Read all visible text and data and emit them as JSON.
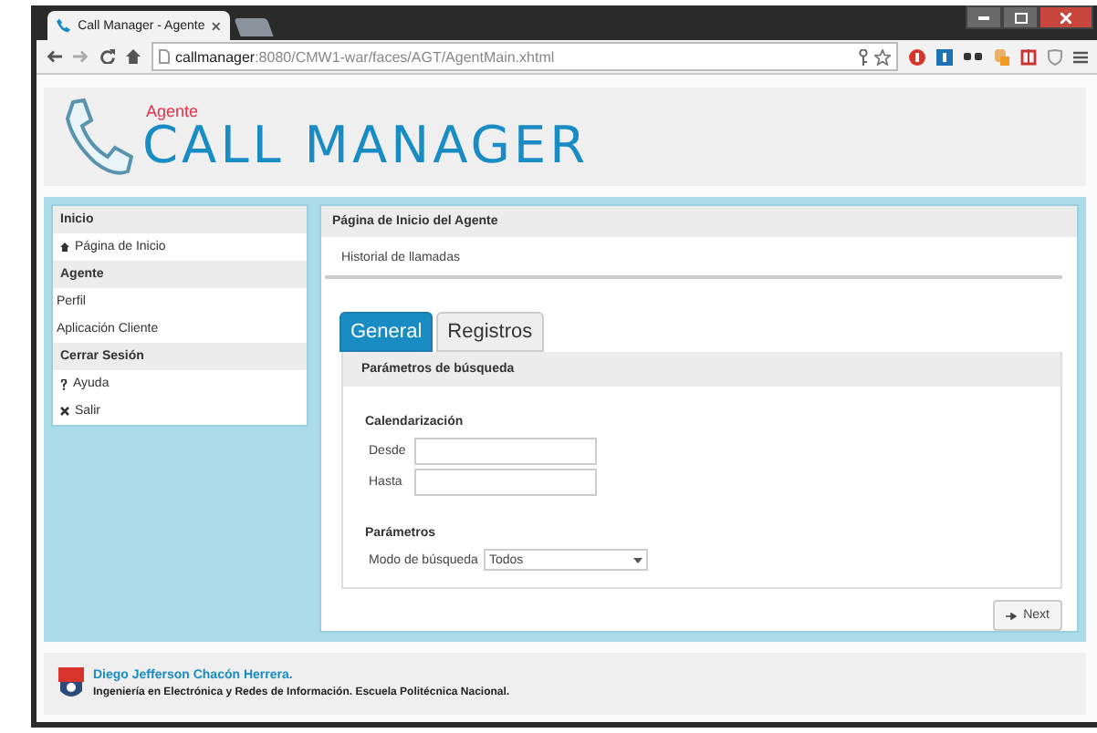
{
  "browser": {
    "tab_title": "Call Manager - Agente",
    "url_host": "callmanager",
    "url_path": ":8080/CMW1-war/faces/AGT/AgentMain.xhtml"
  },
  "header": {
    "subtitle": "Agente",
    "title": "CALL MANAGER"
  },
  "sidebar": {
    "sections": [
      {
        "header": "Inicio",
        "items": [
          {
            "label": "Página de Inicio",
            "kind": "home"
          }
        ]
      },
      {
        "header": "Agente",
        "items": [
          {
            "label": "Perfil",
            "kind": "plain"
          },
          {
            "label": "Aplicación Cliente",
            "kind": "plain"
          }
        ]
      },
      {
        "header": "Cerrar Sesión",
        "items": [
          {
            "label": "Ayuda",
            "kind": "help"
          },
          {
            "label": "Salir",
            "kind": "close"
          }
        ]
      }
    ]
  },
  "main": {
    "panel_title": "Página de Inicio del Agente",
    "subtitle": "Historial de llamadas",
    "tabs": [
      {
        "label": "General",
        "selected": true
      },
      {
        "label": "Registros",
        "selected": false
      }
    ],
    "fieldset_title": "Parámetros de búsqueda",
    "schedule_title": "Calendarización",
    "date_fields": [
      {
        "label": "Desde"
      },
      {
        "label": "Hasta"
      }
    ],
    "params_title": "Parámetros",
    "search_mode": {
      "label": "Modo de búsqueda",
      "value": "Todos"
    },
    "next_button": "Next"
  },
  "footer": {
    "author": "Diego Jefferson Chacón Herrera.",
    "institution": "Ingeniería en Electrónica y Redes de Información. Escuela Politécnica Nacional."
  }
}
